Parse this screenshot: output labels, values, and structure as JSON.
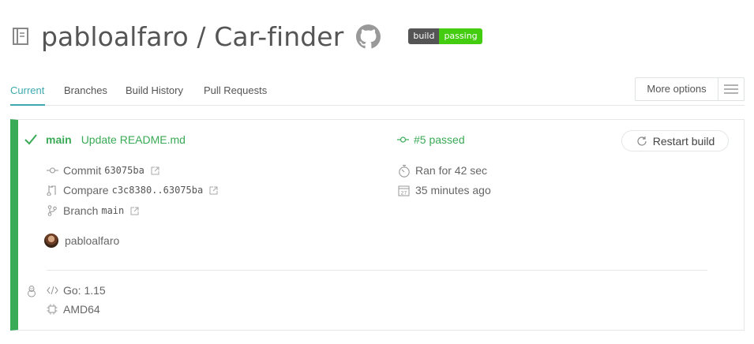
{
  "repo": {
    "owner": "pabloalfaro",
    "separator": " / ",
    "name": "Car-finder",
    "title": "pabloalfaro / Car-finder",
    "badge_left": "build",
    "badge_right": "passing",
    "badge_color": "#44cc11"
  },
  "tabs": [
    {
      "label": "Current",
      "active": true
    },
    {
      "label": "Branches",
      "active": false
    },
    {
      "label": "Build History",
      "active": false
    },
    {
      "label": "Pull Requests",
      "active": false
    }
  ],
  "more_options": {
    "label": "More options",
    "icon": "hamburger-icon"
  },
  "build": {
    "status_color": "#39aa56",
    "branch": "main",
    "commit_message": "Update README.md",
    "number_text": "#5 passed",
    "restart_label": "Restart build",
    "commit_label": "Commit",
    "commit_sha": "63075ba",
    "compare_label": "Compare",
    "compare_range": "c3c8380..63075ba",
    "branch_label": "Branch",
    "branch_value": "main",
    "duration": "Ran for 42 sec",
    "finished": "35 minutes ago",
    "author": "pabloalfaro",
    "language": "Go: 1.15",
    "arch": "AMD64"
  },
  "colors": {
    "accent": "#3eaaaf",
    "passed": "#39aa56"
  }
}
